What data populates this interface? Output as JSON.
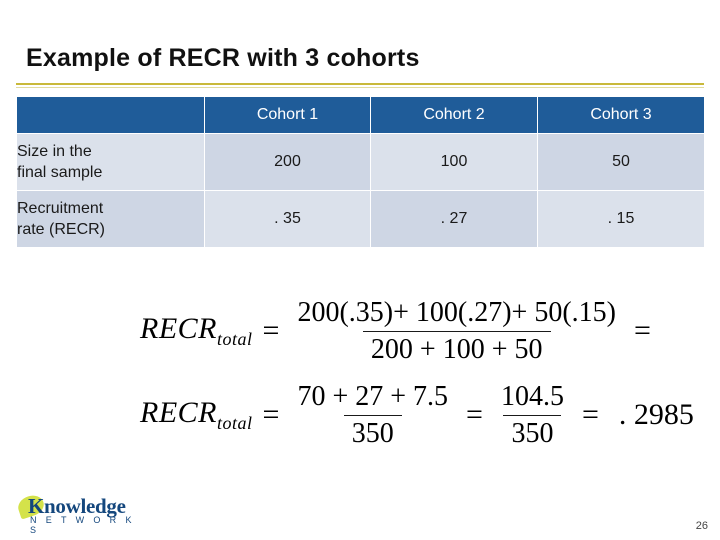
{
  "slide": {
    "title": "Example of RECR with 3 cohorts",
    "page_number": "26"
  },
  "table": {
    "corner_label": "",
    "columns": [
      "Cohort 1",
      "Cohort 2",
      "Cohort 3"
    ],
    "rows": [
      {
        "label_line1": "Size in the",
        "label_line2": "final sample",
        "values": [
          "200",
          "100",
          "50"
        ]
      },
      {
        "label_line1": "Recruitment",
        "label_line2": "rate (RECR)",
        "values": [
          ". 35",
          ". 27",
          ". 15"
        ]
      }
    ]
  },
  "formula": {
    "line1": {
      "lhs": "RECR",
      "lhs_sub": "total",
      "equals": "=",
      "numerator": "200(.35)+ 100(.27)+ 50(.15)",
      "denominator": "200 + 100 + 50",
      "trailing": "="
    },
    "line2": {
      "lhs": "RECR",
      "lhs_sub": "total",
      "equals": "=",
      "numerator1": "70 + 27 + 7.5",
      "denominator1": "350",
      "equals2": "=",
      "numerator2": "104.5",
      "denominator2": "350",
      "equals3": "=",
      "result": ". 2985"
    }
  },
  "logo": {
    "name": "Knowledge",
    "subtitle": "N E T W O R K S"
  },
  "colors": {
    "header_blue": "#1f5c99",
    "row_light": "#dbe1eb",
    "row_dark": "#ced6e4",
    "rule_gold": "#c9b93a",
    "logo_blue": "#14477d",
    "logo_green": "#d4e24a"
  }
}
